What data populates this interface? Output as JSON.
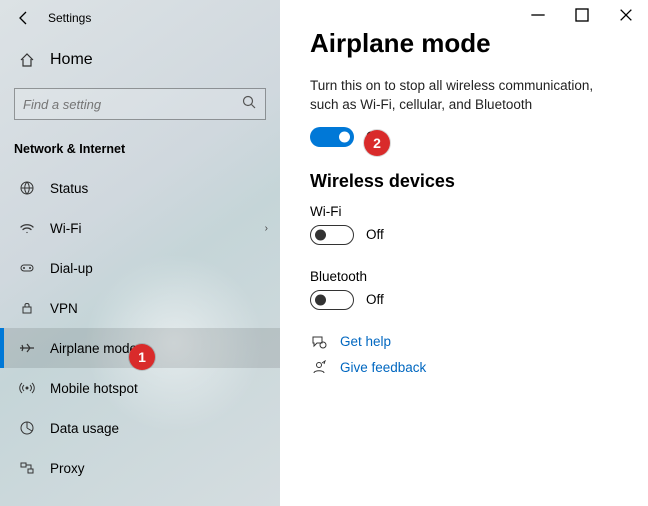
{
  "titlebar": {
    "title": "Settings"
  },
  "sidebar": {
    "home": "Home",
    "search_placeholder": "Find a setting",
    "section": "Network & Internet",
    "items": [
      {
        "label": "Status"
      },
      {
        "label": "Wi-Fi"
      },
      {
        "label": "Dial-up"
      },
      {
        "label": "VPN"
      },
      {
        "label": "Airplane mode"
      },
      {
        "label": "Mobile hotspot"
      },
      {
        "label": "Data usage"
      },
      {
        "label": "Proxy"
      }
    ]
  },
  "main": {
    "heading": "Airplane mode",
    "desc": "Turn this on to stop all wireless communication, such as Wi-Fi, cellular, and Bluetooth",
    "airplane_toggle": {
      "state": "On"
    },
    "wireless_heading": "Wireless devices",
    "wifi": {
      "label": "Wi-Fi",
      "state": "Off"
    },
    "bt": {
      "label": "Bluetooth",
      "state": "Off"
    },
    "help": "Get help",
    "feedback": "Give feedback"
  },
  "annotations": {
    "1": "1",
    "2": "2"
  }
}
